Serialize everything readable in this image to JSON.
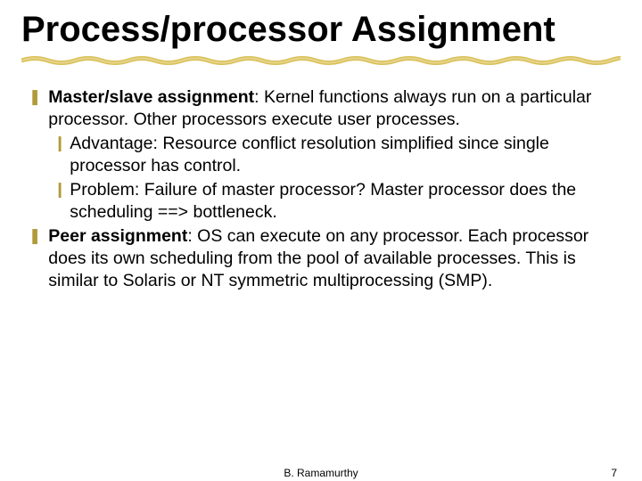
{
  "title": "Process/processor Assignment",
  "bullets": [
    {
      "level": 1,
      "bold": "Master/slave assignment",
      "rest": ": Kernel functions always run on a particular processor. Other processors execute user processes."
    },
    {
      "level": 2,
      "text": "Advantage: Resource conflict resolution simplified since single processor has control."
    },
    {
      "level": 2,
      "text": "Problem: Failure of master processor? Master processor does the scheduling ==> bottleneck."
    },
    {
      "level": 1,
      "bold": "Peer assignment",
      "rest": ": OS can execute on any processor. Each processor does its own scheduling from the pool of available processes. This is similar to Solaris or NT symmetric multiprocessing (SMP)."
    }
  ],
  "footer": {
    "center": "B. Ramamurthy",
    "page": "7"
  },
  "marks": {
    "lvl1": "❚",
    "lvl2": "❙"
  }
}
